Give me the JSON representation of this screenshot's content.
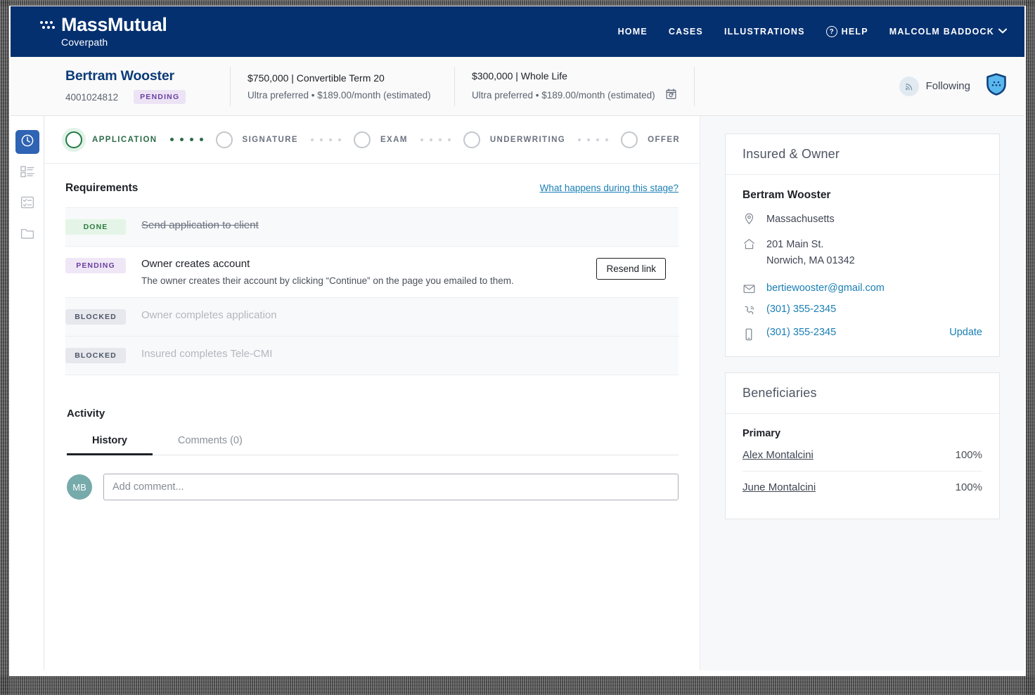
{
  "brand": {
    "name": "MassMutual",
    "sub": "Coverpath",
    "dots_icon": "massmutual-dots-icon"
  },
  "topnav": {
    "items": [
      {
        "label": "HOME",
        "name": "home"
      },
      {
        "label": "CASES",
        "name": "cases"
      },
      {
        "label": "ILLUSTRATIONS",
        "name": "illustrations"
      }
    ],
    "help": {
      "label": "HELP",
      "glyph": "?",
      "icon": "help-circle-icon"
    },
    "user": {
      "label": "MALCOLM BADDOCK",
      "caret": "▾",
      "icon": "chevron-down-icon"
    },
    "background": "#053070"
  },
  "case_header": {
    "name": "Bertram Wooster",
    "number": "4001024812",
    "status": "PENDING",
    "policies": [
      {
        "amount_type": "$750,000 | Convertible Term 20",
        "detail": "Ultra preferred • $189.00/month (estimated)"
      },
      {
        "amount_type": "$300,000 | Whole Life",
        "detail": "Ultra preferred • $189.00/month (estimated)",
        "icon": "calendar-refresh-icon"
      }
    ],
    "following_label": "Following",
    "following_icon": "rss-signal-icon",
    "shield_icon": "shield-badge-icon"
  },
  "rail": {
    "items": [
      {
        "name": "clock-icon",
        "label": "Timeline",
        "active": true
      },
      {
        "name": "list-icon",
        "label": "Details",
        "active": false
      },
      {
        "name": "checklist-icon",
        "label": "Tasks",
        "active": false
      },
      {
        "name": "folder-icon",
        "label": "Documents",
        "active": false
      }
    ]
  },
  "stepper": {
    "steps": [
      {
        "label": "APPLICATION",
        "active": true
      },
      {
        "label": "SIGNATURE",
        "active": false
      },
      {
        "label": "EXAM",
        "active": false
      },
      {
        "label": "UNDERWRITING",
        "active": false
      },
      {
        "label": "OFFER",
        "active": false
      }
    ]
  },
  "requirements": {
    "title": "Requirements",
    "help_link": "What happens during this stage?",
    "items": [
      {
        "status": "DONE",
        "title": "Send application to client",
        "desc": "",
        "action": ""
      },
      {
        "status": "PENDING",
        "title": "Owner creates account",
        "desc": "The owner creates their account by clicking “Continue” on the page you emailed to them.",
        "action": "Resend link"
      },
      {
        "status": "BLOCKED",
        "title": "Owner completes application",
        "desc": "",
        "action": ""
      },
      {
        "status": "BLOCKED",
        "title": "Insured completes Tele-CMI",
        "desc": "",
        "action": ""
      }
    ]
  },
  "activity": {
    "title": "Activity",
    "tabs": [
      {
        "label": "History",
        "active": true
      },
      {
        "label": "Comments (0)",
        "active": false
      }
    ],
    "avatar_initials": "MB",
    "comment_placeholder": "Add comment..."
  },
  "insured_owner": {
    "card_title": "Insured & Owner",
    "name": "Bertram Wooster",
    "state": "Massachusetts",
    "address_line1": "201 Main St.",
    "address_line2": "Norwich, MA 01342",
    "email": "bertiewooster@gmail.com",
    "phone": "(301) 355-2345",
    "mobile": "(301) 355-2345",
    "update_label": "Update",
    "icons": {
      "state": "map-pin-icon",
      "address": "home-icon",
      "email": "envelope-icon",
      "phone": "phone-icon",
      "mobile": "mobile-phone-icon"
    }
  },
  "beneficiaries": {
    "card_title": "Beneficiaries",
    "group_label": "Primary",
    "rows": [
      {
        "name": "Alex Montalcini",
        "pct": "100%"
      },
      {
        "name": "June Montalcini",
        "pct": "100%"
      }
    ]
  },
  "colors": {
    "nav_blue": "#053070",
    "brand_blue": "#0b3b77",
    "link_blue": "#1a7fb5",
    "active_green": "#1e7a43",
    "pending_purple": "#6b3fa0",
    "rail_active": "#2f63b3",
    "avatar_teal": "#76aaab"
  }
}
